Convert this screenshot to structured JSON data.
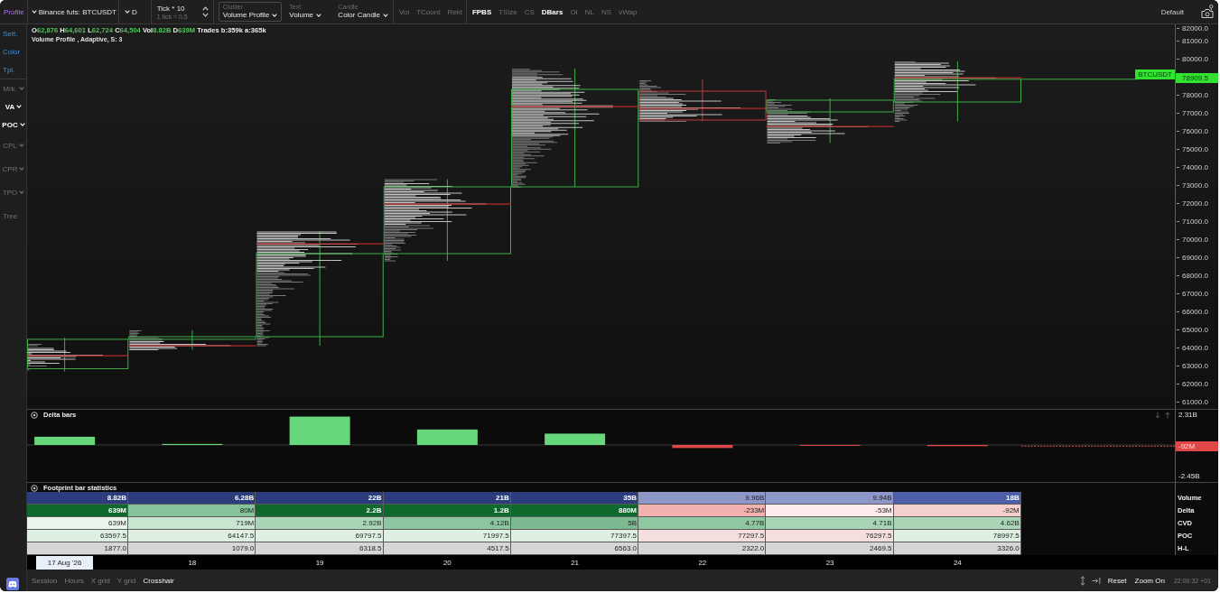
{
  "toolbar": {
    "mode": "Profile",
    "symbol": "Binance futs: BTCUSDT",
    "timeframe": "D",
    "tick": {
      "value": "Tick * 10",
      "hint": "1 tick = 0.5"
    },
    "dropdowns": [
      {
        "caption": "Cluster",
        "value": "Volume Profile",
        "selected": true
      },
      {
        "caption": "Text",
        "value": "Volume",
        "selected": false
      },
      {
        "caption": "Candle",
        "value": "Color Candle",
        "selected": false
      }
    ],
    "toggle_groups": [
      {
        "items": [
          {
            "label": "Vol",
            "on": false
          },
          {
            "label": "TCount",
            "on": false
          },
          {
            "label": "Rekt",
            "on": false
          }
        ]
      },
      {
        "items": [
          {
            "label": "FPBS",
            "on": true
          },
          {
            "label": "TSize",
            "on": false
          },
          {
            "label": "CS",
            "on": false
          },
          {
            "label": "DBars",
            "on": true
          },
          {
            "label": "OI",
            "on": false
          },
          {
            "label": "NL",
            "on": false
          },
          {
            "label": "NS",
            "on": false
          },
          {
            "label": "vWap",
            "on": false
          }
        ]
      }
    ],
    "template": "Default"
  },
  "sidebar": {
    "links": [
      "Sett.",
      "Color",
      "Tpl."
    ],
    "toggles": [
      {
        "label": "Mrk.",
        "kind": "dropdown",
        "on": false
      },
      {
        "label": "VA",
        "kind": "dropdown",
        "on": true
      },
      {
        "label": "POC",
        "kind": "dropdown",
        "on": true
      },
      {
        "label": "CPL",
        "kind": "dropdown",
        "on": false
      },
      {
        "label": "CPR",
        "kind": "dropdown",
        "on": false
      },
      {
        "label": "TPO",
        "kind": "dropdown",
        "on": false
      },
      {
        "label": "Tree",
        "kind": "toggle",
        "on": false
      }
    ]
  },
  "chart": {
    "ohlc": [
      {
        "key": "O",
        "value": "62,876"
      },
      {
        "key": "H",
        "value": "64,601"
      },
      {
        "key": "L",
        "value": "62,724"
      },
      {
        "key": "C",
        "value": "64,504"
      },
      {
        "key": "Vol",
        "value": "8.82B"
      },
      {
        "key": "D",
        "value": "639M"
      }
    ],
    "trades": "Trades b:359k a:365k",
    "study": "Volume Profile , Adaptive, S: 3",
    "price_axis": {
      "upper": [
        "82000.0",
        "81000.0",
        "80000.0"
      ],
      "lower": [
        "78000.0",
        "77000.0",
        "76000.0",
        "75000.0",
        "74000.0",
        "73000.0",
        "72000.0",
        "71000.0",
        "70000.0",
        "69000.0",
        "68000.0",
        "67000.0",
        "66000.0",
        "65000.0",
        "64000.0",
        "63000.0",
        "62000.0",
        "61000.0"
      ]
    },
    "last_price": {
      "symbol": "BTCUSDT",
      "price": "78909.5"
    }
  },
  "delta_panel": {
    "title": "Delta bars",
    "axis_labels": [
      "2.31B",
      "-2.45B"
    ],
    "last_value": "-92M"
  },
  "stats_panel": {
    "title": "Footprint bar statistics",
    "rows": [
      {
        "label": "Volume",
        "cells": [
          {
            "value": "8.82B",
            "color": "#2c3d7e"
          },
          {
            "value": "6.28B",
            "color": "#2c3d7e"
          },
          {
            "value": "22B",
            "color": "#2c3d7e"
          },
          {
            "value": "21B",
            "color": "#2c3d7e"
          },
          {
            "value": "35B",
            "color": "#2c3d7e"
          },
          {
            "value": "9.96B",
            "color": "#8d98c9"
          },
          {
            "value": "9.94B",
            "color": "#8d98c9"
          },
          {
            "value": "18B",
            "color": "#4c5fa8"
          }
        ]
      },
      {
        "label": "Delta",
        "cells": [
          {
            "value": "639M",
            "color": "#0d6a2c"
          },
          {
            "value": "80M",
            "color": "#86c39c"
          },
          {
            "value": "2.2B",
            "color": "#0d6a2c"
          },
          {
            "value": "1.2B",
            "color": "#0d6a2c"
          },
          {
            "value": "880M",
            "color": "#0d6a2c"
          },
          {
            "value": "-233M",
            "color": "#f2b3b0"
          },
          {
            "value": "-53M",
            "color": "#fdeceb"
          },
          {
            "value": "-92M",
            "color": "#f6d0cf"
          }
        ]
      },
      {
        "label": "CVD",
        "cells": [
          {
            "value": "639M",
            "color": "#eaf5ec"
          },
          {
            "value": "719M",
            "color": "#c9e6d1"
          },
          {
            "value": "2.92B",
            "color": "#a9d6b6"
          },
          {
            "value": "4.12B",
            "color": "#8cc5a0"
          },
          {
            "value": "5B",
            "color": "#7dba92"
          },
          {
            "value": "4.77B",
            "color": "#8fc7a1"
          },
          {
            "value": "4.71B",
            "color": "#a8d5b5"
          },
          {
            "value": "4.62B",
            "color": "#aad6b7"
          }
        ]
      },
      {
        "label": "POC",
        "cells": [
          {
            "value": "63597.5",
            "color": "#dff0e3"
          },
          {
            "value": "64147.5",
            "color": "#dff0e3"
          },
          {
            "value": "69797.5",
            "color": "#dff0e3"
          },
          {
            "value": "71997.5",
            "color": "#dff0e3"
          },
          {
            "value": "77397.5",
            "color": "#dff0e3"
          },
          {
            "value": "77297.5",
            "color": "#f4dfde"
          },
          {
            "value": "76297.5",
            "color": "#f4dfde"
          },
          {
            "value": "78997.5",
            "color": "#dff0e3"
          }
        ]
      },
      {
        "label": "H-L",
        "cells": [
          {
            "value": "1877.0",
            "color": "#d6d6d6"
          },
          {
            "value": "1079.0",
            "color": "#d6d6d6"
          },
          {
            "value": "6318.5",
            "color": "#d6d6d6"
          },
          {
            "value": "4517.5",
            "color": "#d6d6d6"
          },
          {
            "value": "6563.0",
            "color": "#d6d6d6"
          },
          {
            "value": "2322.0",
            "color": "#d6d6d6"
          },
          {
            "value": "2469.5",
            "color": "#d6d6d6"
          },
          {
            "value": "3326.0",
            "color": "#d6d6d6"
          }
        ]
      }
    ]
  },
  "x_axis": [
    {
      "label": "17 Aug '26",
      "selected": true
    },
    {
      "label": "18",
      "selected": false
    },
    {
      "label": "19",
      "selected": false
    },
    {
      "label": "20",
      "selected": false
    },
    {
      "label": "21",
      "selected": false
    },
    {
      "label": "22",
      "selected": false
    },
    {
      "label": "23",
      "selected": false
    },
    {
      "label": "24",
      "selected": false
    }
  ],
  "status_bar": {
    "toggles": [
      {
        "label": "Session",
        "on": false
      },
      {
        "label": "Hours",
        "on": false
      },
      {
        "label": "X grid",
        "on": false
      },
      {
        "label": "Y grid",
        "on": false
      },
      {
        "label": "Crosshair",
        "on": true
      }
    ],
    "actions": [
      "Reset",
      "Zoom On"
    ],
    "time": "22:00:32 +01"
  }
}
